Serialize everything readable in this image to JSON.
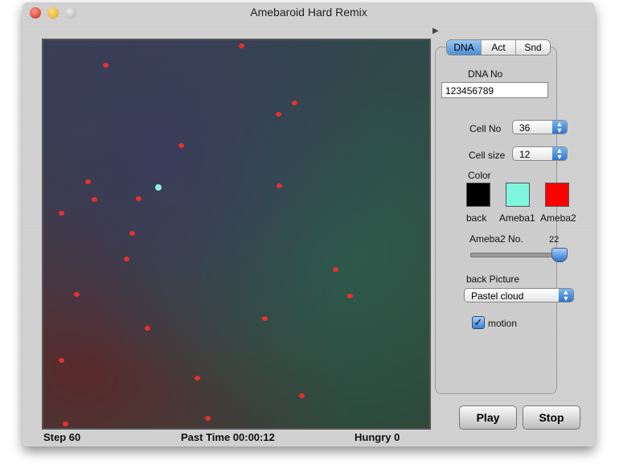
{
  "window": {
    "title": "Amebaroid Hard Remix"
  },
  "tabs": [
    {
      "label": "DNA"
    },
    {
      "label": "Act"
    },
    {
      "label": "Snd"
    }
  ],
  "dna": {
    "label": "DNA No",
    "value": "123456789"
  },
  "cell_no": {
    "label": "Cell No",
    "value": "36"
  },
  "cell_size": {
    "label": "Cell size",
    "value": "12"
  },
  "color": {
    "label": "Color",
    "swatches": [
      {
        "label": "back",
        "color": "#000000"
      },
      {
        "label": "Ameba1",
        "color": "#7ff5de"
      },
      {
        "label": "Ameba2",
        "color": "#ff0000"
      }
    ]
  },
  "ameba2": {
    "label": "Ameba2 No.",
    "value": "22",
    "fraction": 1.0
  },
  "back_picture": {
    "label": "back Picture",
    "value": "Pastel cloud"
  },
  "motion": {
    "label": "motion",
    "checked": true
  },
  "buttons": {
    "play": "Play",
    "stop": "Stop"
  },
  "status": {
    "step": "Step  60",
    "past_time": "Past Time 00:00:12",
    "hungry": "Hungry  0"
  }
}
